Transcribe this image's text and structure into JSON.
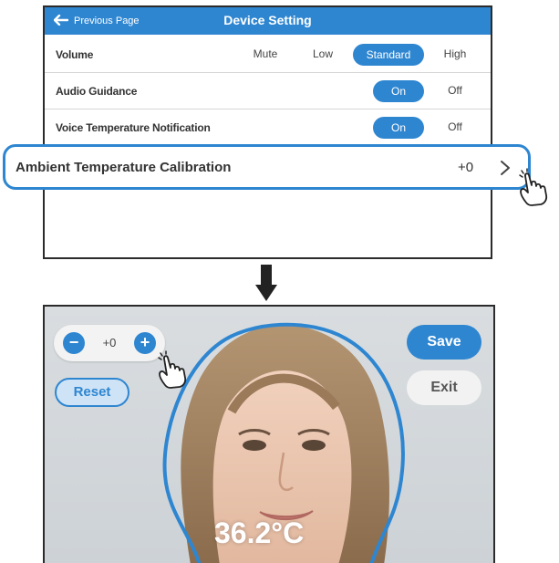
{
  "device_setting": {
    "back_label": "Previous Page",
    "title": "Device Setting",
    "rows": {
      "volume": {
        "label": "Volume",
        "options": [
          "Mute",
          "Low",
          "Standard",
          "High"
        ],
        "selected": "Standard"
      },
      "audio_guidance": {
        "label": "Audio Guidance",
        "on": "On",
        "off": "Off",
        "selected": "On"
      },
      "voice_temp": {
        "label": "Voice Temperature Notification",
        "on": "On",
        "off": "Off",
        "selected": "On"
      }
    },
    "calibration": {
      "label": "Ambient Temperature Calibration",
      "value": "+0"
    }
  },
  "calibration_screen": {
    "stepper_value": "+0",
    "minus_symbol": "−",
    "plus_symbol": "+",
    "reset_label": "Reset",
    "save_label": "Save",
    "exit_label": "Exit",
    "temperature": "36.2°C"
  },
  "colors": {
    "accent": "#2e86d1",
    "header": "#2e86d1",
    "selected_pill": "#2e86d1"
  },
  "icons": [
    "back-arrow-icon",
    "chevron-right-icon",
    "hand-pointer-icon",
    "down-arrow-icon"
  ]
}
